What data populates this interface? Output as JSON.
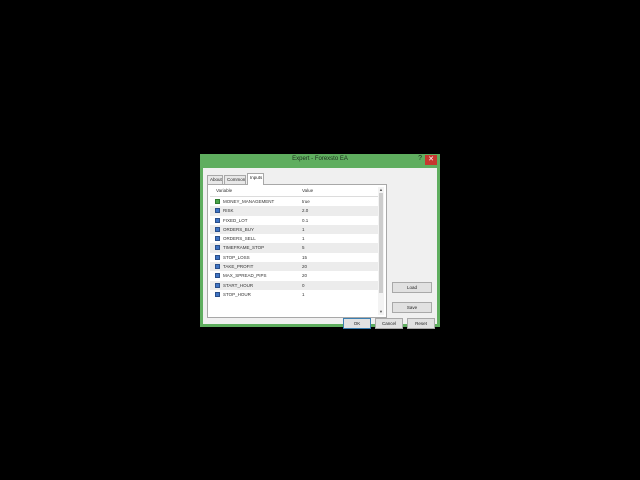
{
  "window": {
    "title": "Expert - Forexsto EA",
    "help_label": "?",
    "close_label": "✕"
  },
  "tabs": [
    {
      "label": "About"
    },
    {
      "label": "Common"
    },
    {
      "label": "Inputs"
    }
  ],
  "table": {
    "headers": {
      "variable": "Variable",
      "value": "Value"
    },
    "rows": [
      {
        "name": "MONEY_MANAGEMENT",
        "value": "true",
        "icon": "boolean-icon"
      },
      {
        "name": "RISK",
        "value": "2.0",
        "icon": "number-icon"
      },
      {
        "name": "FIXED_LOT",
        "value": "0.1",
        "icon": "number-icon"
      },
      {
        "name": "ORDERS_BUY",
        "value": "1",
        "icon": "number-icon"
      },
      {
        "name": "ORDERS_SELL",
        "value": "1",
        "icon": "number-icon"
      },
      {
        "name": "TIMEFRAME_STOP",
        "value": "5",
        "icon": "number-icon"
      },
      {
        "name": "STOP_LOSS",
        "value": "15",
        "icon": "number-icon"
      },
      {
        "name": "TAKE_PROFIT",
        "value": "20",
        "icon": "number-icon"
      },
      {
        "name": "MAX_SPREAD_PIPS",
        "value": "20",
        "icon": "number-icon"
      },
      {
        "name": "START_HOUR",
        "value": "0",
        "icon": "number-icon"
      },
      {
        "name": "STOP_HOUR",
        "value": "1",
        "icon": "number-icon"
      }
    ]
  },
  "buttons": {
    "load": "Load",
    "save": "Save",
    "ok": "OK",
    "cancel": "Cancel",
    "reset": "Reset"
  },
  "colors": {
    "window_frame": "#5fae5f",
    "close_button": "#c7372f",
    "background": "#000000"
  }
}
